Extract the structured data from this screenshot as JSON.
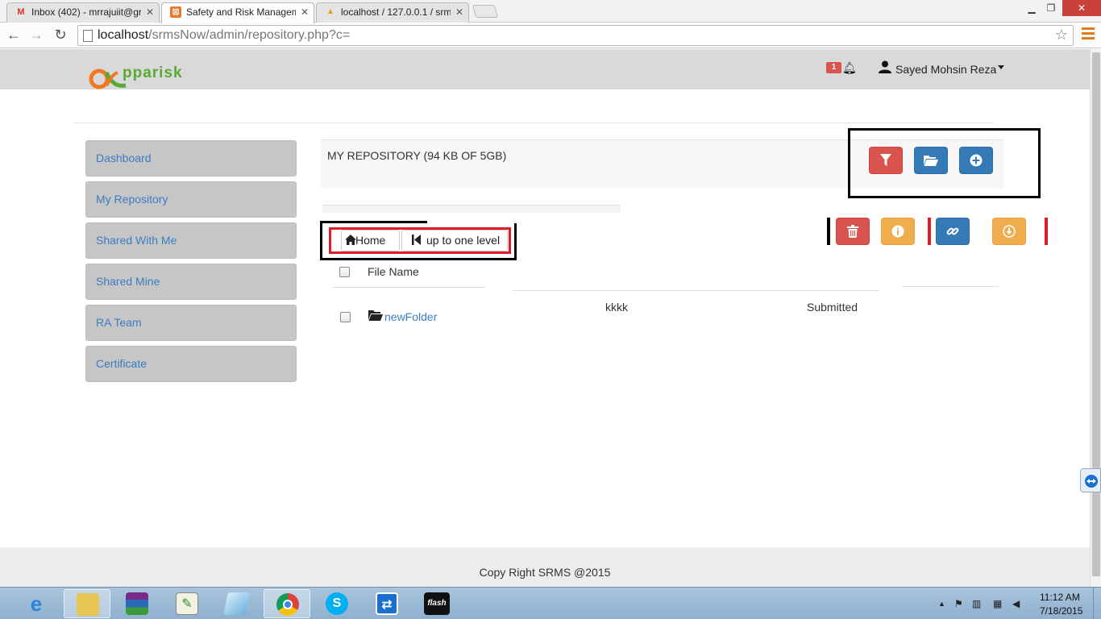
{
  "browser": {
    "tabs": [
      {
        "title": "Inbox (402) - mrrajuiit@gr",
        "favicon": "gmail-icon",
        "active": false
      },
      {
        "title": "Safety and Risk Managem",
        "favicon": "site-icon",
        "active": true
      },
      {
        "title": "localhost / 127.0.0.1 / srm",
        "favicon": "phpmyadmin-icon",
        "active": false
      }
    ],
    "url_host": "localhost",
    "url_path": "/srmsNow/admin/repository.php?c="
  },
  "header": {
    "logo_text": "pparisk",
    "notification_count": "1",
    "user_name": "Sayed Mohsin Reza"
  },
  "sidebar": {
    "items": [
      {
        "label": "Dashboard"
      },
      {
        "label": "My Repository"
      },
      {
        "label": "Shared With Me"
      },
      {
        "label": "Shared Mine"
      },
      {
        "label": "RA Team"
      },
      {
        "label": "Certificate"
      }
    ]
  },
  "repository": {
    "title": "MY REPOSITORY (94 KB OF 5GB)"
  },
  "navigation": {
    "home_label": "Home",
    "up_label": "up to one level"
  },
  "file_table": {
    "header_file_name": "File Name",
    "rows": [
      {
        "name": "newFolder",
        "col2": "kkkk",
        "status": "Submitted"
      }
    ]
  },
  "footer": {
    "text": "Copy Right SRMS @2015"
  },
  "taskbar": {
    "time": "11:12 AM",
    "date": "7/18/2015"
  },
  "colors": {
    "danger": "#d9534f",
    "primary": "#337ab7",
    "warning": "#f0ad4e",
    "annotation_red": "#e21b2b",
    "link": "#3a7cc4"
  }
}
